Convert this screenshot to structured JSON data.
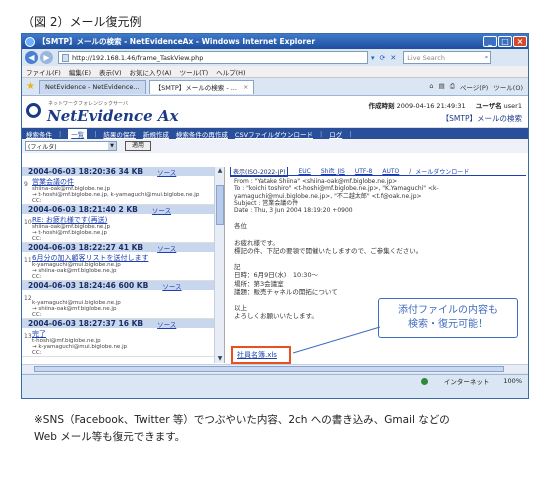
{
  "figure_caption": "（図 2）メール復元例",
  "window": {
    "title": "【SMTP】メールの検索 - NetEvidenceAx - Windows Internet Explorer",
    "address": "http://192.168.1.46/frame_TaskView.php",
    "search_placeholder": "Live Search",
    "menu": [
      "ファイル(F)",
      "編集(E)",
      "表示(V)",
      "お気に入り(A)",
      "ツール(T)",
      "ヘルプ(H)"
    ],
    "tabs": [
      "NetEvidence - NetEvidence...",
      "【SMTP】メールの検索 - ..."
    ],
    "command_bar": [
      "ページ(P)",
      "ツール(O)"
    ],
    "status_zone": "インターネット",
    "zoom": "100%"
  },
  "app": {
    "subtitle": "ネットワークフォレンジックサーバ",
    "logo": "NetEvidence Ax",
    "created_label": "作成時刻",
    "created_value": "2009-04-16 21:49:31",
    "user_label": "ユーザ名",
    "user_value": "user1",
    "page_heading": "【SMTP】メールの検索",
    "nav": [
      "検索条件",
      "一覧",
      "結果の保存",
      "新規作成",
      "検索条件の再作成",
      "CSVファイルダウンロード",
      "ログ"
    ],
    "filter_value": "(フィルタ)",
    "apply_label": "適用"
  },
  "mail_list": [
    {
      "num": "9",
      "date": "2004-06-03 18:20:36",
      "size": "34 KB",
      "src": "ソース",
      "subject": "営業会議の件",
      "lines": [
        "shiina-oak@mf.biglobe.ne.jp",
        "→ t-hoshi@mf.biglobe.ne.jp, k-yamaguchi@mui.biglobe.ne.jp",
        "CC:"
      ]
    },
    {
      "num": "10",
      "date": "2004-06-03 18:21:40",
      "size": "2 KB",
      "src": "ソース",
      "subject": "RE: お疲れ様です(再送)",
      "lines": [
        "shiina-oak@mf.biglobe.ne.jp",
        "→ t-hoshi@mf.biglobe.ne.jp",
        "CC:"
      ]
    },
    {
      "num": "11",
      "date": "2004-06-03 18:22:27",
      "size": "41 KB",
      "src": "ソース",
      "subject": "6月分の加入顧客リストを送付します",
      "lines": [
        "k-yamaguchi@mui.biglobe.ne.jp",
        "→ shiina-oak@mf.biglobe.ne.jp",
        "CC:"
      ]
    },
    {
      "num": "12",
      "date": "2004-06-03 18:24:46",
      "size": "600 KB",
      "src": "ソース",
      "subject": "",
      "lines": [
        "k-yamaguchi@mui.biglobe.ne.jp",
        "→ shiina-oak@mf.biglobe.ne.jp",
        "CC:"
      ]
    },
    {
      "num": "13",
      "date": "2004-06-03 18:27:37",
      "size": "16 KB",
      "src": "ソース",
      "subject": "完了",
      "lines": [
        "t-hoshi@mf.biglobe.ne.jp",
        "→ k-yamaguchi@mui.biglobe.ne.jp",
        "CC:"
      ]
    }
  ],
  "encoding_tabs": [
    "表示(ISO-2022-JP)",
    "EUC",
    "Shift_JIS",
    "UTF-8",
    "AUTO",
    "メールダウンロード"
  ],
  "mail_view": {
    "from": "From : \"Yatake Shiina\" <shiina-oak@mf.biglobe.ne.jp>",
    "to": "To : \"koichi toshiro\" <t-hoshi@mf.biglobe.ne.jp>, \"K.Yamaguchi\" <k-yamaguchi@mui.biglobe.ne.jp>, \"不二越太郎\" <t.f@oak.ne.jp>",
    "subject": "Subject : 営業会議の件",
    "date": "Date : Thu, 3 Jun 2004 18:19:20 +0900",
    "body": [
      "各位",
      "",
      "お疲れ様です。",
      "標記の件、下記の要領で開催いたしますので、ご参集ください。",
      "",
      "記",
      "日時：6月9日(水)　10:30～",
      "場所：第3会議室",
      "議題：販売チャネルの開拓について",
      "",
      "以上",
      "よろしくお願いいたします。"
    ],
    "attachment": "社員名簿.xls"
  },
  "callout": [
    "添付ファイルの内容も",
    "検索・復元可能！"
  ],
  "footnote": [
    "※SNS（Facebook、Twitter 等）でつぶやいた内容、2ch への書き込み、Gmail などの",
    "Web メール等も復元できます。"
  ]
}
